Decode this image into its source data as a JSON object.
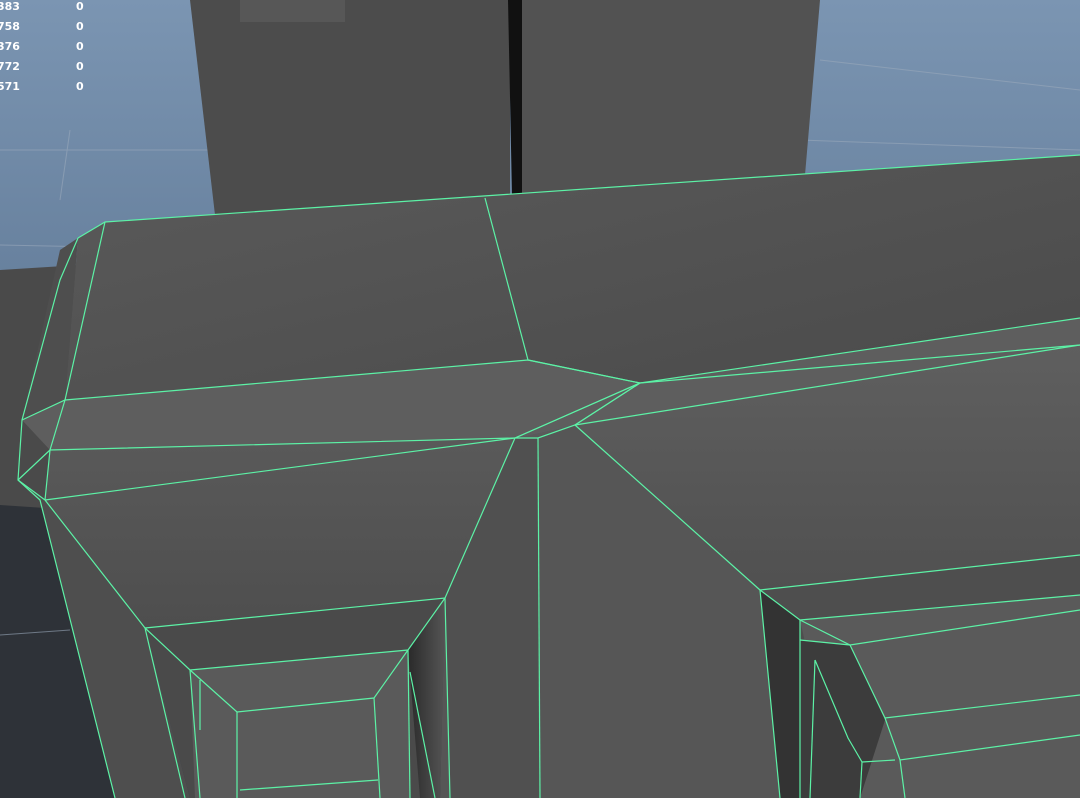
{
  "app": "3D modeling viewport",
  "hud": {
    "rows": [
      {
        "value": "383",
        "count": "0"
      },
      {
        "value": "758",
        "count": "0"
      },
      {
        "value": "376",
        "count": "0"
      },
      {
        "value": "772",
        "count": "0"
      },
      {
        "value": "571",
        "count": "0"
      }
    ]
  },
  "colors": {
    "wireframe": "#5cf2a6",
    "mesh_face": "#5c5c5c",
    "sky_top": "#6f8aa8",
    "sky_bottom": "#485a70",
    "background_box": "#4d4d4d"
  }
}
